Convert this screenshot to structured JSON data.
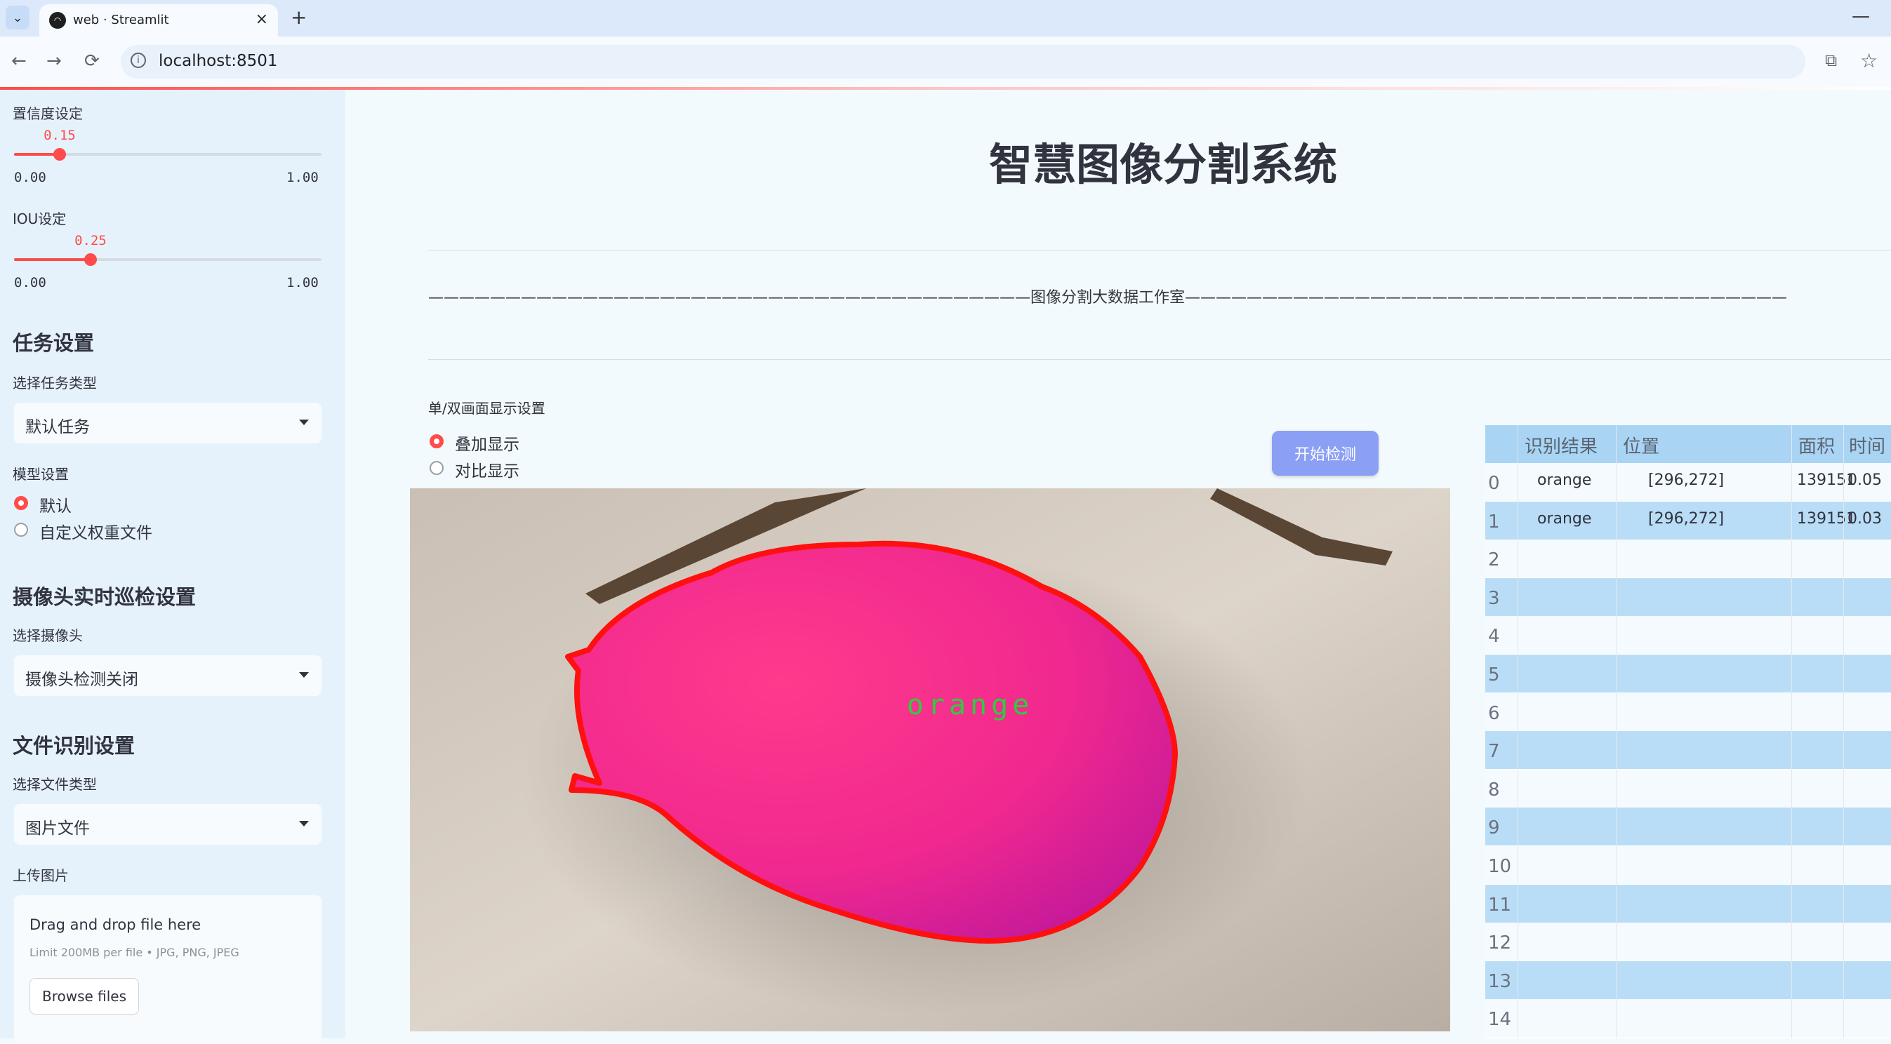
{
  "browser": {
    "tab_title": "web · Streamlit",
    "tab_close": "×",
    "new_tab": "+",
    "minimize": "—",
    "url": "localhost:8501",
    "back": "←",
    "forward": "→",
    "reload": "⟳",
    "info": "i",
    "translate": "⧉",
    "star": "☆"
  },
  "sidebar": {
    "confidence": {
      "label": "置信度设定",
      "value": 0.15,
      "value_text": "0.15",
      "min": "0.00",
      "max": "1.00"
    },
    "iou": {
      "label": "IOU设定",
      "value": 0.25,
      "value_text": "0.25",
      "min": "0.00",
      "max": "1.00"
    },
    "task_header": "任务设置",
    "task_type_label": "选择任务类型",
    "task_type_value": "默认任务",
    "model_label": "模型设置",
    "model_options": [
      "默认",
      "自定义权重文件"
    ],
    "model_selected": 0,
    "camera_header": "摄像头实时巡检设置",
    "camera_label": "选择摄像头",
    "camera_value": "摄像头检测关闭",
    "file_header": "文件识别设置",
    "file_type_label": "选择文件类型",
    "file_type_value": "图片文件",
    "upload_label": "上传图片",
    "upload_title": "Drag and drop file here",
    "upload_limit": "Limit 200MB per file • JPG, PNG, JPEG",
    "browse_label": "Browse files"
  },
  "main": {
    "title": "智慧图像分割系统",
    "divider_text": "———————————————————————————————————————图像分割大数据工作室———————————————————————————————————————",
    "display_label": "单/双画面显示设置",
    "display_options": [
      "叠加显示",
      "对比显示"
    ],
    "display_selected": 0,
    "detect_button": "开始检测",
    "image_label": "orange"
  },
  "table": {
    "headers": [
      "识别结果",
      "位置",
      "面积",
      "时间"
    ],
    "rows": [
      {
        "index": "0",
        "result": "orange",
        "position": "[296,272]",
        "area": "139151",
        "time": "0.05"
      },
      {
        "index": "1",
        "result": "orange",
        "position": "[296,272]",
        "area": "139151",
        "time": "0.03"
      },
      {
        "index": "2"
      },
      {
        "index": "3"
      },
      {
        "index": "4"
      },
      {
        "index": "5"
      },
      {
        "index": "6"
      },
      {
        "index": "7"
      },
      {
        "index": "8"
      },
      {
        "index": "9"
      },
      {
        "index": "10"
      },
      {
        "index": "11"
      },
      {
        "index": "12"
      },
      {
        "index": "13"
      },
      {
        "index": "14"
      }
    ]
  },
  "colors": {
    "accent": "#ff4b4b",
    "button": "#8b9ff5",
    "mask": "#ff2a8a",
    "label": "#2ecc40"
  }
}
